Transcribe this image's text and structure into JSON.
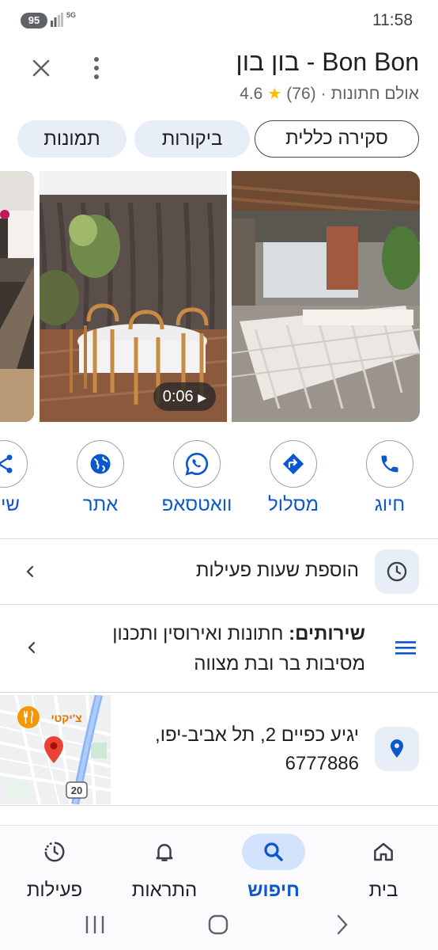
{
  "status_bar": {
    "battery": "95",
    "network": "5G",
    "time": "11:58"
  },
  "header": {
    "title": "Bon Bon - בון בון",
    "rating": "4.6",
    "reviews_count": "(76)",
    "separator": "·",
    "category": "אולם חתונות",
    "star_icon": "star-icon"
  },
  "tabs": [
    {
      "label": "סקירה כללית",
      "active": true
    },
    {
      "label": "ביקורות",
      "active": false
    },
    {
      "label": "תמונות",
      "active": false
    }
  ],
  "photos": {
    "video_duration": "0:06"
  },
  "actions": [
    {
      "label": "חיוג",
      "icon": "phone-icon"
    },
    {
      "label": "מסלול",
      "icon": "directions-icon"
    },
    {
      "label": "וואטסאפ",
      "icon": "whatsapp-icon"
    },
    {
      "label": "אתר",
      "icon": "globe-icon"
    },
    {
      "label": "שית",
      "icon": "share-icon"
    }
  ],
  "info": {
    "hours_label": "הוספת שעות פעילות",
    "services_heading": "שירותים:",
    "services_line1": "חתונות ואירוסין ותכנון",
    "services_line2": "מסיבות בר ובת מצווה",
    "address_line1": "יגיע כפיים 2, תל אביב-יפו,",
    "address_line2": "6777886",
    "map_place_label": "צ'יקטי",
    "map_route_label": "20"
  },
  "bottom_nav": [
    {
      "label": "בית",
      "icon": "home-icon",
      "active": false
    },
    {
      "label": "חיפוש",
      "icon": "search-icon",
      "active": true
    },
    {
      "label": "התראות",
      "icon": "bell-icon",
      "active": false
    },
    {
      "label": "פעילות",
      "icon": "activity-icon",
      "active": false
    }
  ],
  "colors": {
    "accent": "#0b57d0",
    "chip_bg": "#e8eef8",
    "star": "#fbbc04"
  }
}
